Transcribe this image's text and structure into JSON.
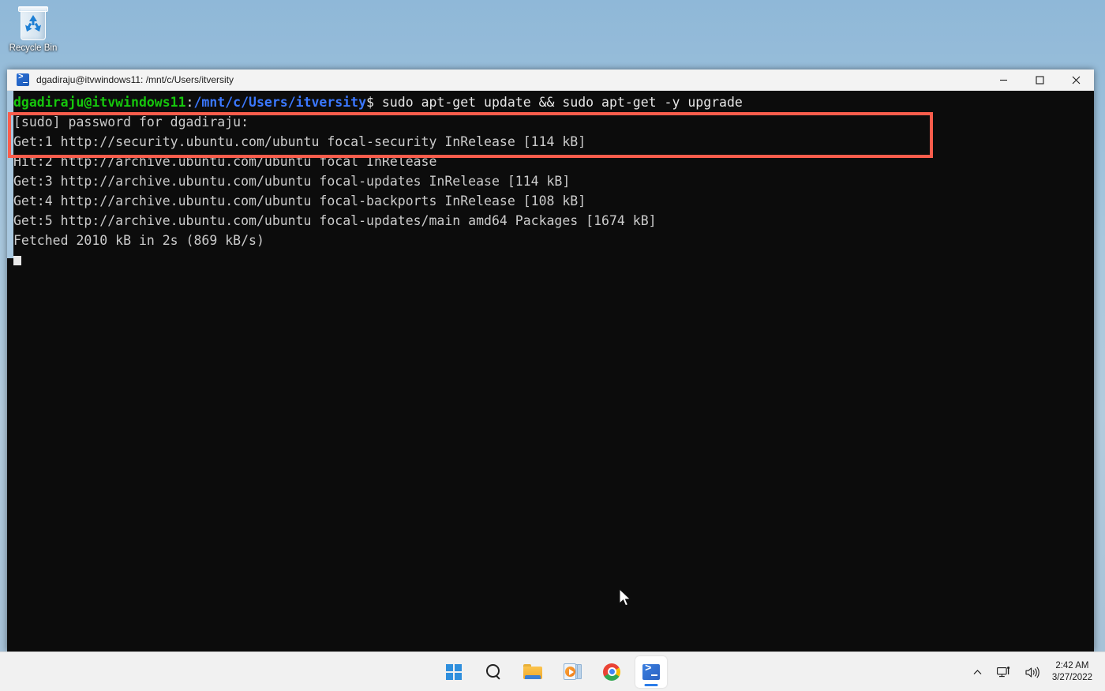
{
  "desktop": {
    "recycle_bin": {
      "label": "Recycle Bin",
      "icon": "recycle-bin-icon"
    },
    "wallpaper_color": "#a8c7dd"
  },
  "window": {
    "title": "dgadiraju@itvwindows11: /mnt/c/Users/itversity",
    "icon": "wsl-terminal-icon",
    "controls": {
      "minimize": "minimize-button",
      "maximize": "maximize-button",
      "close": "close-button"
    }
  },
  "terminal": {
    "background": "#0c0c0c",
    "highlight_color": "#fa5d4c",
    "prompt": {
      "user_host": "dgadiraju@itvwindows11",
      "separator": ":",
      "path": "/mnt/c/Users/itversity",
      "symbol": "$",
      "command": " sudo apt-get update && sudo apt-get -y upgrade"
    },
    "colors": {
      "user_host": "#16c60c",
      "path": "#3b78ff",
      "text": "#cccccc"
    },
    "lines": [
      "[sudo] password for dgadiraju:",
      "Get:1 http://security.ubuntu.com/ubuntu focal-security InRelease [114 kB]",
      "Hit:2 http://archive.ubuntu.com/ubuntu focal InRelease",
      "Get:3 http://archive.ubuntu.com/ubuntu focal-updates InRelease [114 kB]",
      "Get:4 http://archive.ubuntu.com/ubuntu focal-backports InRelease [108 kB]",
      "Get:5 http://archive.ubuntu.com/ubuntu focal-updates/main amd64 Packages [1674 kB]",
      "Fetched 2010 kB in 2s (869 kB/s)"
    ]
  },
  "taskbar": {
    "items": [
      {
        "name": "start-button",
        "icon": "windows-start-icon",
        "label": "Start",
        "active": false
      },
      {
        "name": "search-button",
        "icon": "search-icon",
        "label": "Search",
        "active": false
      },
      {
        "name": "file-explorer-button",
        "icon": "folder-icon",
        "label": "File Explorer",
        "active": false
      },
      {
        "name": "media-player-button",
        "icon": "media-player-icon",
        "label": "Media Player",
        "active": false
      },
      {
        "name": "chrome-button",
        "icon": "chrome-icon",
        "label": "Google Chrome",
        "active": false
      },
      {
        "name": "terminal-button",
        "icon": "terminal-icon",
        "label": "Windows Terminal",
        "active": true
      }
    ],
    "tray": {
      "chevron": "chevron-up-icon",
      "network": "network-icon",
      "volume": "volume-icon",
      "time": "2:42 AM",
      "date": "3/27/2022"
    }
  }
}
